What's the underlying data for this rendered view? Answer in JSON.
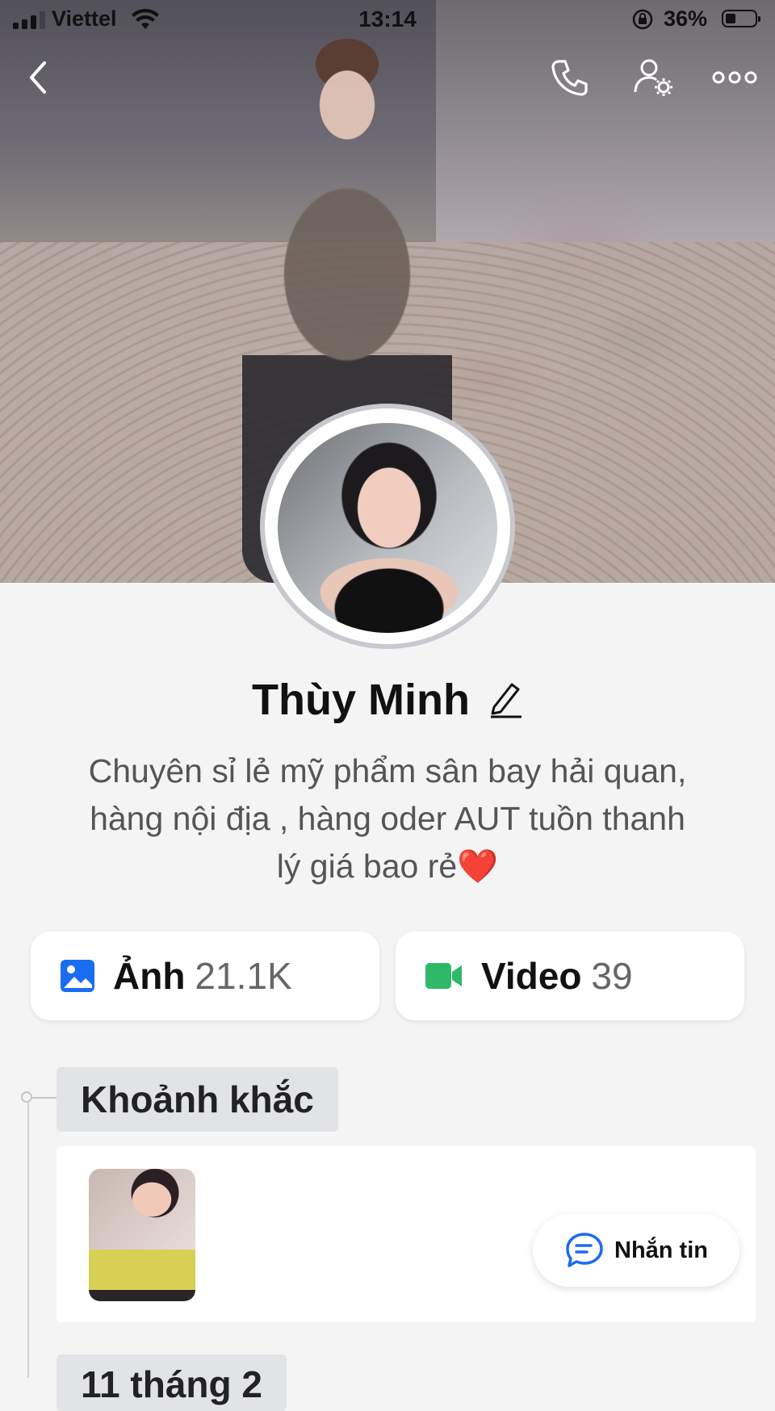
{
  "status_bar": {
    "carrier": "Viettel",
    "time": "13:14",
    "battery": "36%"
  },
  "profile": {
    "name": "Thùy Minh",
    "bio_line1": "Chuyên sỉ lẻ mỹ phẩm sân bay hải quan,",
    "bio_line2": "hàng nội địa , hàng oder AUT tuồn thanh",
    "bio_line3": "lý giá bao rẻ",
    "bio_emoji": "❤️"
  },
  "stats": {
    "photos_label": "Ảnh",
    "photos_count": "21.1K",
    "videos_label": "Video",
    "videos_count": "39"
  },
  "timeline": {
    "section1": "Khoảnh khắc",
    "section2": "11 tháng 2"
  },
  "actions": {
    "message": "Nhắn tin"
  },
  "colors": {
    "photo_icon": "#1a6cf0",
    "video_icon": "#2fb86a",
    "message_icon": "#1a6cf0",
    "heart": "#e0262b"
  }
}
